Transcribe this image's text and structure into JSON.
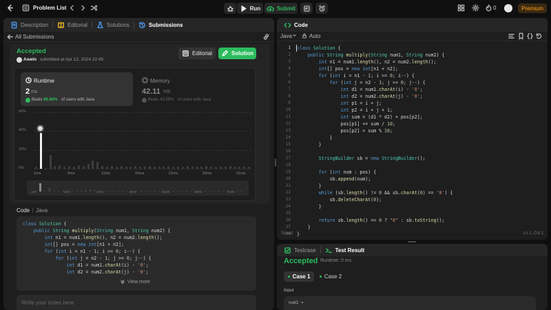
{
  "header": {
    "problem_list": "Problem List",
    "run": "Run",
    "submit": "Submit",
    "streak": "0",
    "premium": "Premium"
  },
  "left_tabs": [
    {
      "label": "Description"
    },
    {
      "label": "Editorial"
    },
    {
      "label": "Solutions"
    },
    {
      "label": "Submissions"
    }
  ],
  "submission": {
    "back_label": "All Submissions",
    "status": "Accepted",
    "author": "Aswin",
    "submitted_text": "submitted at Apr 12, 2024 22:45",
    "editorial_btn": "Editorial",
    "solution_btn": "Solution",
    "runtime": {
      "label": "Runtime",
      "value": "2",
      "unit": "ms",
      "beats_prefix": "Beats",
      "beats_pct": "98.68%",
      "beats_suffix": "of users with Java"
    },
    "memory": {
      "label": "Memory",
      "value": "42.11",
      "unit": "MB",
      "beats_prefix": "Beats",
      "beats_pct": "43.55%",
      "beats_suffix": "of users with Java"
    }
  },
  "chart_data": {
    "type": "bar",
    "y_ticks": [
      "60%",
      "40%",
      "20%",
      "0%"
    ],
    "ylim": [
      0,
      60
    ],
    "x_ticks": [
      "1ms",
      "6ms",
      "11ms",
      "16ms",
      "21ms",
      "26ms",
      "31ms"
    ],
    "values": [
      2,
      38,
      0,
      15,
      3,
      4,
      2,
      3,
      2,
      4,
      3,
      5,
      9,
      7,
      3,
      2,
      3,
      2,
      3,
      2,
      2,
      3,
      2,
      2,
      3,
      2,
      2,
      2,
      3,
      2,
      2,
      2,
      3,
      2,
      2,
      2,
      3,
      2,
      2,
      2,
      2,
      3,
      2,
      2,
      2,
      2
    ],
    "highlight_index": 1,
    "minimap_values": [
      2,
      38,
      0,
      15,
      3,
      4,
      2,
      3,
      2,
      4,
      3,
      5,
      9,
      7,
      3,
      2,
      3,
      2,
      3,
      2,
      2,
      3,
      2,
      2,
      3,
      2,
      2,
      2,
      3,
      2,
      2,
      2,
      3,
      2,
      2,
      2,
      3,
      2,
      2,
      2,
      2,
      3,
      2,
      2,
      2,
      2
    ]
  },
  "code_section": {
    "label": "Code",
    "lang": "Java",
    "view_more": "View more",
    "notes_placeholder": "Write your notes here"
  },
  "editor": {
    "title": "Code",
    "lang": "Java",
    "mode": "Auto",
    "saved": "Saved",
    "cursor": "Ln 1, Col 1",
    "lines": [
      "<span class='kw'>class</span> <span class='ty'>Solution</span> {",
      "    <span class='kw'>public</span> <span class='ty'>String</span> <span class='fn'>multiply</span>(<span class='ty'>String</span> num1, <span class='ty'>String</span> num2) {",
      "        <span class='kw'>int</span> n1 = num1.<span class='fn'>length</span>(), n2 = num2.<span class='fn'>length</span>();",
      "        <span class='kw'>int</span>[] pos = <span class='kw'>new</span> <span class='kw'>int</span>[n1 + n2];",
      "        <span class='kw'>for</span> (<span class='kw'>int</span> i = n1 - <span class='nm'>1</span>; i &gt;= <span class='nm'>0</span>; i--) {",
      "            <span class='kw'>for</span> (<span class='kw'>int</span> j = n2 - <span class='nm'>1</span>; j &gt;= <span class='nm'>0</span>; j--) {",
      "                <span class='kw'>int</span> d1 = num1.<span class='fn'>charAt</span>(i) - <span class='st'>'0'</span>;",
      "                <span class='kw'>int</span> d2 = num2.<span class='fn'>charAt</span>(j) - <span class='st'>'0'</span>;",
      "                <span class='kw'>int</span> p1 = i + j;",
      "                <span class='kw'>int</span> p2 = i + j + <span class='nm'>1</span>;",
      "                <span class='kw'>int</span> sum = (d1 * d2) + pos[p2];",
      "                pos[p1] += sum / <span class='nm'>10</span>;",
      "                pos[p2] = sum % <span class='nm'>10</span>;",
      "            }",
      "        }",
      "",
      "        <span class='ty'>StringBuilder</span> sb = <span class='kw'>new</span> <span class='ty'>StringBuilder</span>();",
      "",
      "        <span class='kw'>for</span> (<span class='kw'>int</span> num : pos) {",
      "            sb.<span class='fn'>append</span>(num);",
      "        }",
      "        <span class='kw'>while</span> (sb.<span class='fn'>length</span>() != <span class='nm'>0</span> &amp;&amp; sb.<span class='fn'>charAt</span>(<span class='nm'>0</span>) == <span class='st'>'0'</span>) {",
      "            sb.<span class='fn'>deleteCharAt</span>(<span class='nm'>0</span>);",
      "        }",
      "",
      "        <span class='kw'>return</span> sb.<span class='fn'>length</span>() == <span class='nm'>0</span> ? <span class='st'>\"0\"</span> : sb.<span class='fn'>toString</span>();",
      "    }",
      "}"
    ],
    "preview_lines": [
      "<span class='kw'>class</span> <span class='ty'>Solution</span> {",
      "    <span class='kw'>public</span> <span class='ty'>String</span> <span class='fn'>multiply</span>(<span class='ty'>String</span> num1, <span class='ty'>String</span> num2) {",
      "        <span class='kw'>int</span> n1 = num1.<span class='fn'>length</span>(), n2 = num2.<span class='fn'>length</span>();",
      "        <span class='kw'>int</span>[] pos = <span class='kw'>new</span> <span class='kw'>int</span>[n1 + n2];",
      "        <span class='kw'>for</span> (<span class='kw'>int</span> i = n1 - <span class='nm'>1</span>; i &gt;= <span class='nm'>0</span>; i--) {",
      "            <span class='kw'>for</span> (<span class='kw'>int</span> j = n2 - <span class='nm'>1</span>; j &gt;= <span class='nm'>0</span>; j--) {",
      "                <span class='kw'>int</span> d1 = num1.<span class='fn'>charAt</span>(i) - <span class='st'>'0'</span>;",
      "                <span class='kw'>int</span> d2 = num2.<span class='fn'>charAt</span>(j) - <span class='st'>'0'</span>;"
    ]
  },
  "bottom": {
    "tab_testcase": "Testcase",
    "tab_result": "Test Result",
    "status": "Accepted",
    "runtime_text": "Runtime: 0 ms",
    "cases": [
      "Case 1",
      "Case 2"
    ],
    "input_label": "Input",
    "input_value": "num1 ="
  },
  "colors": {
    "accent_green": "#2cbb5d",
    "premium": "#ffa116",
    "bg": "#0f0f0f",
    "panel": "#1e1e1e"
  }
}
